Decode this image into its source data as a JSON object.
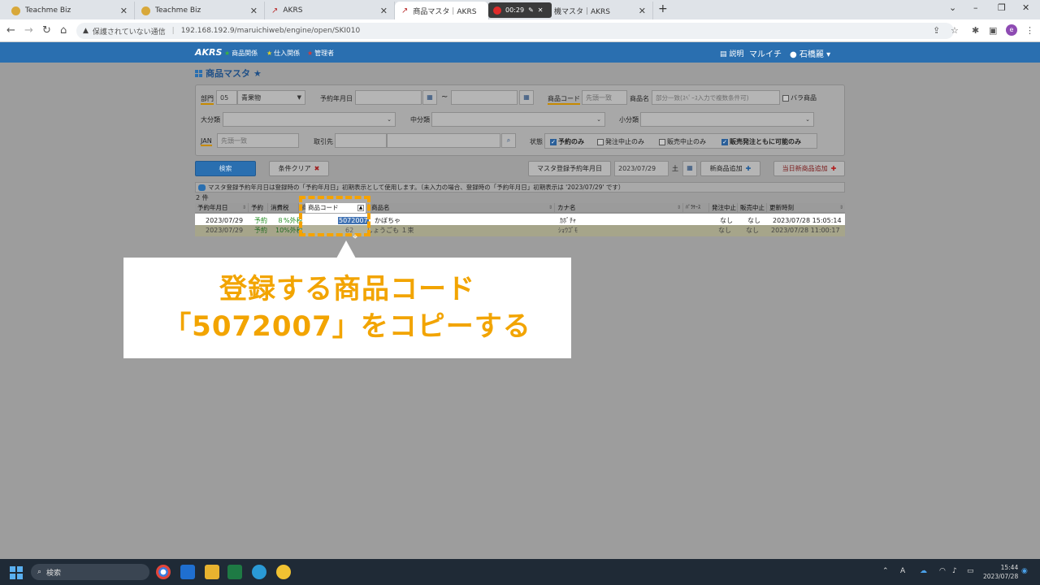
{
  "browser": {
    "tabs": [
      {
        "label": "Teachme Biz"
      },
      {
        "label": "Teachme Biz"
      },
      {
        "label": "AKRS"
      },
      {
        "label": "商品マスタ｜AKRS"
      },
      {
        "label": "機マスタ｜AKRS"
      }
    ],
    "recorder_time": "00:29",
    "security_label": "保護されていない通信",
    "url": "192.168.192.9/maruichiweb/engine/open/SKI010",
    "profile_initial": "e"
  },
  "app": {
    "logo": "AKRS",
    "nav": [
      "商品関係",
      "仕入関係",
      "管理者"
    ],
    "help_label": "説明",
    "company": "マルイチ",
    "user": "石橋麗"
  },
  "page": {
    "title": "商品マスタ"
  },
  "search": {
    "dept_label": "部門",
    "dept_code": "05",
    "dept_name": "青果物",
    "reserve_date_label": "予約年月日",
    "range_sep": "~",
    "code_label": "商品コード",
    "code_placeholder": "先頭一致",
    "name_label": "商品名",
    "name_placeholder": "部分一致(ｽﾍﾟｰｽ入力で複数条件可)",
    "bara_label": "バラ商品",
    "major_label": "大分類",
    "middle_label": "中分類",
    "minor_label": "小分類",
    "jan_label": "JAN",
    "jan_placeholder": "先頭一致",
    "supplier_label": "取引先",
    "status_label": "状態",
    "status_options": [
      "予約のみ",
      "発注中止のみ",
      "販売中止のみ",
      "販売発注ともに可能のみ"
    ],
    "status_checked": [
      true,
      false,
      false,
      true
    ],
    "search_button": "検索",
    "clear_button": "条件クリア",
    "master_date_label": "マスタ登録予約年月日",
    "master_date": "2023/07/29",
    "master_date_suffix": "土",
    "new_button": "新商品追加",
    "today_new_button": "当日新商品追加"
  },
  "notice": "マスタ登録予約年月日は登録時の「予約年月日」初期表示として使用します。（未入力の場合、登録時の「予約年月日」初期表示は '2023/07/29' です）",
  "result_count": "2 件",
  "table": {
    "headers": [
      "予約年月日",
      "予約",
      "消費税",
      "商品コード",
      "商品名",
      "カナ名",
      "ﾊﾞﾗｹｰｽ",
      "発注中止",
      "販売中止",
      "更新時刻"
    ],
    "rows": [
      [
        "2023/07/29",
        "予約",
        "８%外税",
        "5072007",
        "かぼちゃ",
        "ｶﾎﾞﾁｬ",
        "",
        "なし",
        "なし",
        "2023/07/28 15:05:14"
      ],
      [
        "2023/07/29",
        "予約",
        "10%外税",
        "62",
        "しょうごも １束",
        "ｼｮｳｺﾞﾓ",
        "",
        "なし",
        "なし",
        "2023/07/28 11:00:17"
      ]
    ]
  },
  "callout": {
    "line1": "登録する商品コード",
    "line2": "「5072007」をコピーする"
  },
  "taskbar": {
    "search_label": "検索",
    "ime": "A",
    "time": "15:44",
    "date": "2023/07/28"
  }
}
